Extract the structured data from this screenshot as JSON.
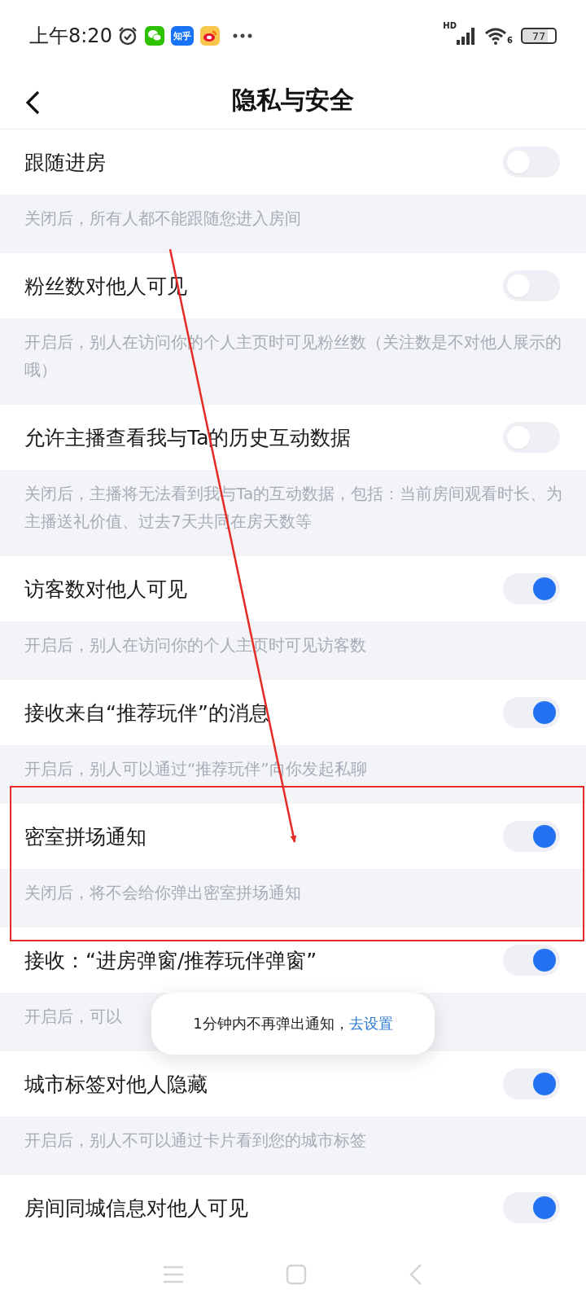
{
  "status_bar": {
    "time": "上午8:20",
    "apps": [
      {
        "kind": "wechat"
      },
      {
        "kind": "zhihu",
        "label": "知乎"
      },
      {
        "kind": "weibo"
      }
    ],
    "network": "HD",
    "wifi_band": "6",
    "battery": "77"
  },
  "header": {
    "title": "隐私与安全"
  },
  "settings": [
    {
      "label": "跟随进房",
      "on": false,
      "hint": "关闭后，所有人都不能跟随您进入房间"
    },
    {
      "label": "粉丝数对他人可见",
      "on": false,
      "hint": "开启后，别人在访问你的个人主页时可见粉丝数（关注数是不对他人展示的哦）"
    },
    {
      "label": "允许主播查看我与Ta的历史互动数据",
      "on": false,
      "hint": "关闭后，主播将无法看到我与Ta的互动数据，包括：当前房间观看时长、为主播送礼价值、过去7天共同在房天数等"
    },
    {
      "label": "访客数对他人可见",
      "on": true,
      "hint": "开启后，别人在访问你的个人主页时可见访客数"
    },
    {
      "label": "接收来自“推荐玩伴”的消息",
      "on": true,
      "hint": "开启后，别人可以通过“推荐玩伴”向你发起私聊"
    },
    {
      "label": "密室拼场通知",
      "on": true,
      "hint": "关闭后，将不会给你弹出密室拼场通知"
    },
    {
      "label": "接收：“进房弹窗/推荐玩伴弹窗”",
      "on": true,
      "hint": "开启后，可以"
    },
    {
      "label": "城市标签对他人隐藏",
      "on": true,
      "hint": "开启后，别人不可以通过卡片看到您的城市标签"
    },
    {
      "label": "房间同城信息对他人可见",
      "on": true
    }
  ],
  "toast": {
    "text": "1分钟内不再弹出通知，",
    "link": "去设置"
  }
}
